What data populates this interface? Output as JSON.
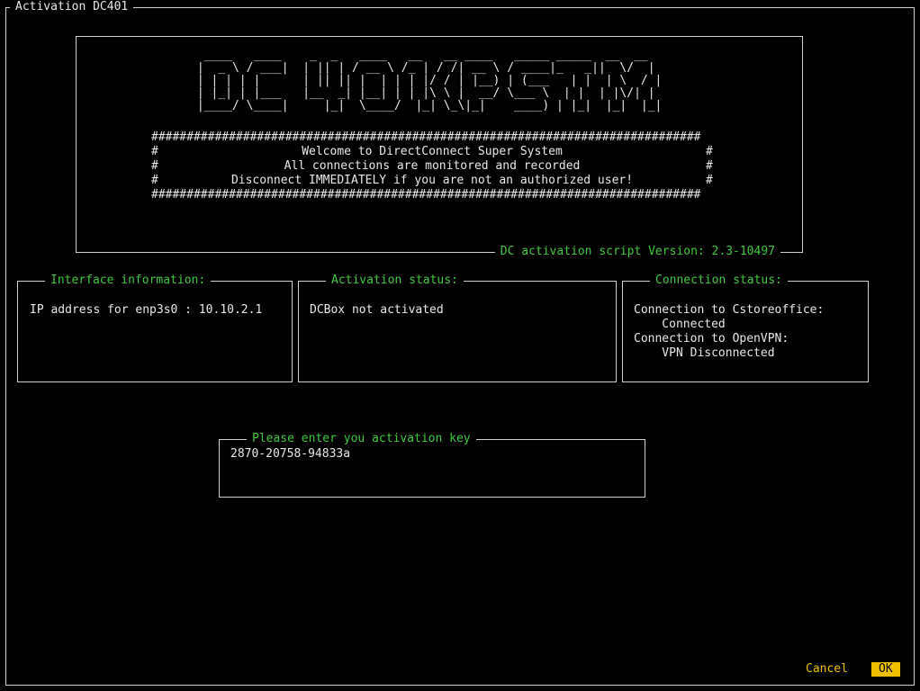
{
  "window": {
    "title": "Activation DC401"
  },
  "banner": {
    "ascii_logo": [
      "  ____   ____    _  _   ____   __   __ ____   _____ _____  __  __ ",
      " |  _ \\ / ___|  | || | / __ \\ /_ | / /| __ \\ / ____|_   _||  \\/  |",
      " | | | | |      | || || |  | | | |/ / | |__) | (___   | |  | \\  / |",
      " | |_| | |___   |__  _| |__| | | |\\ \\ |  __/ \\___ \\  | |  | |\\/| |",
      " |____/ \\____|     |_|  \\____/  |_| \\_\\|_|    ____) | |_|  |_|  |_|"
    ],
    "hash_border": "##############################################################################",
    "message_lines": [
      "Welcome to DirectConnect Super System",
      "All connections are monitored and recorded",
      "Disconnect IMMEDIATELY if you are not an authorized user!"
    ],
    "version": "DC activation script Version: 2.3-10497"
  },
  "panels": {
    "interface": {
      "title": "Interface information:",
      "lines": [
        "IP address for enp3s0 : 10.10.2.1"
      ]
    },
    "activation": {
      "title": "Activation status:",
      "lines": [
        "DCBox not activated"
      ]
    },
    "connection": {
      "title": "Connection status:",
      "lines": [
        "Connection to Cstoreoffice:",
        "    Connected",
        "Connection to OpenVPN:",
        "    VPN Disconnected"
      ]
    }
  },
  "key_input": {
    "label": "Please enter you activation key",
    "value": "2870-20758-94833a"
  },
  "buttons": {
    "cancel": "Cancel",
    "ok": "OK"
  },
  "colors": {
    "accent": "#3fc83f",
    "button": "#f0c000",
    "background": "#000000"
  }
}
